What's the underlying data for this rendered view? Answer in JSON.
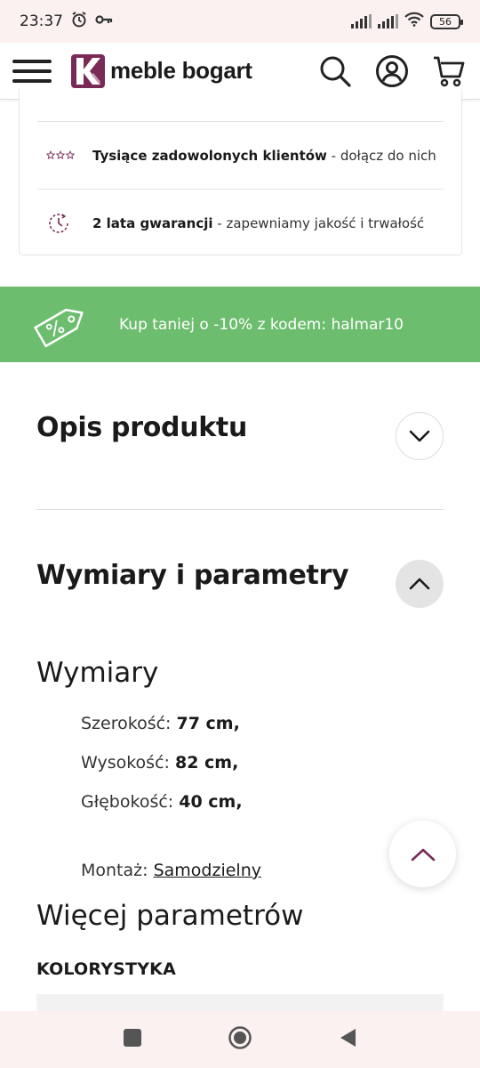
{
  "status_bar": {
    "time": "23:37",
    "battery": "56"
  },
  "header": {
    "logo_text": "meble bogart",
    "brand_color": "#7a2a57"
  },
  "trust": {
    "row1_bold": "Tysiące zadowolonych klientów",
    "row1_rest": " - dołącz do nich",
    "row2_bold": "2 lata gwarancji",
    "row2_rest": " - zapewniamy jakość i trwałość"
  },
  "promo": {
    "text": "Kup taniej o -10% z kodem: halmar10",
    "color": "#6dbd6f"
  },
  "sections": {
    "description_title": "Opis produktu",
    "dimensions_title": "Wymiary i parametry"
  },
  "dimensions": {
    "heading": "Wymiary",
    "width_label": "Szerokość: ",
    "width_value": "77 cm,",
    "height_label": "Wysokość: ",
    "height_value": "82 cm,",
    "depth_label": "Głębokość: ",
    "depth_value": "40 cm,",
    "assembly_label": "Montaż: ",
    "assembly_value": "Samodzielny"
  },
  "more_params": {
    "heading": "Więcej parametrów",
    "color_label": "KOLORYSTYKA"
  },
  "icons": [
    "alarm-icon",
    "key-icon",
    "signal-icon",
    "wifi-icon",
    "battery-icon",
    "menu-icon",
    "search-icon",
    "account-icon",
    "cart-icon",
    "stars-icon",
    "warranty-clock-icon",
    "discount-tag-icon",
    "chevron-down-icon",
    "chevron-up-icon",
    "scroll-top-icon",
    "nav-square-icon",
    "nav-circle-icon",
    "nav-back-icon"
  ]
}
